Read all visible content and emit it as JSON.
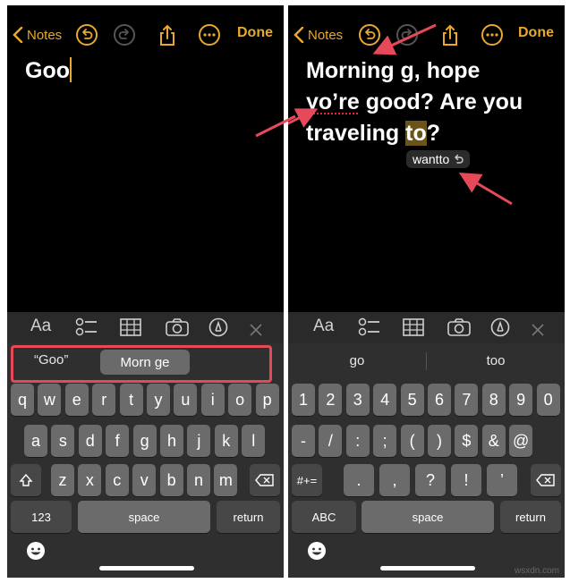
{
  "colors": {
    "accent": "#e8a92c",
    "background": "#000000",
    "keyboard": "#2f2f2f",
    "key": "#6b6b6b",
    "highlight_box": "#e64a5a",
    "arrow": "#e64a5a"
  },
  "panel1": {
    "nav": {
      "back_label": "Notes",
      "done_label": "Done"
    },
    "note_text": "Goo",
    "suggestions": [
      "“Goo”",
      "Morn ge"
    ],
    "row1": [
      "q",
      "w",
      "e",
      "r",
      "t",
      "y",
      "u",
      "i",
      "o",
      "p"
    ],
    "row2": [
      "a",
      "s",
      "d",
      "f",
      "g",
      "h",
      "j",
      "k",
      "l"
    ],
    "row3": [
      "z",
      "x",
      "c",
      "v",
      "b",
      "n",
      "m"
    ],
    "bottom": {
      "numbers": "123",
      "space": "space",
      "return": "return"
    }
  },
  "panel2": {
    "nav": {
      "back_label": "Notes",
      "done_label": "Done"
    },
    "line1": "Morning g, hope",
    "line2_mis": "yo’re",
    "line2_rest": " good? Are you",
    "line3_pre": "traveling ",
    "line3_hl": "to",
    "line3_post": "?",
    "autocorrect_pill": "wantto",
    "suggestions": [
      "go",
      "too"
    ],
    "row1": [
      "1",
      "2",
      "3",
      "4",
      "5",
      "6",
      "7",
      "8",
      "9",
      "0"
    ],
    "row2": [
      "-",
      "/",
      ":",
      ";",
      "(",
      ")",
      "$",
      "&",
      "@"
    ],
    "row3": [
      ".",
      ",",
      "?",
      "!",
      "’"
    ],
    "row3_left": "#+=",
    "bottom": {
      "abc": "ABC",
      "space": "space",
      "return": "return"
    }
  },
  "watermark": "wsxdn.com"
}
